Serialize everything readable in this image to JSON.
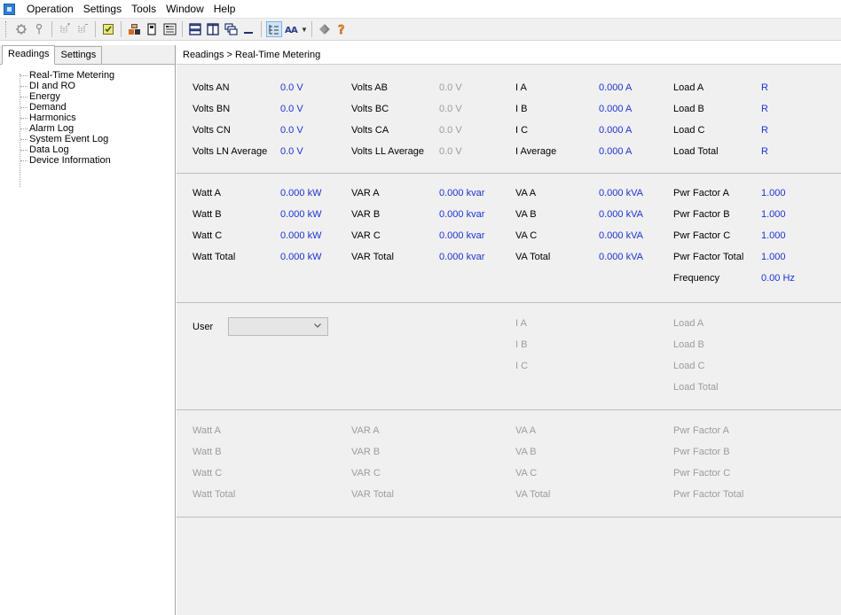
{
  "menu": [
    "Operation",
    "Settings",
    "Tools",
    "Window",
    "Help"
  ],
  "tabs": [
    "Readings",
    "Settings"
  ],
  "tree": [
    "Real-Time Metering",
    "DI and RO",
    "Energy",
    "Demand",
    "Harmonics",
    "Alarm Log",
    "System Event Log",
    "Data Log",
    "Device Information"
  ],
  "breadcrumb": "Readings > Real-Time Metering",
  "sec1": {
    "volts_an_label": "Volts AN",
    "volts_an_value": "0.0 V",
    "volts_bn_label": "Volts BN",
    "volts_bn_value": "0.0 V",
    "volts_cn_label": "Volts CN",
    "volts_cn_value": "0.0 V",
    "volts_ln_avg_label": "Volts LN Average",
    "volts_ln_avg_value": "0.0 V",
    "volts_ab_label": "Volts AB",
    "volts_ab_value": "0.0 V",
    "volts_bc_label": "Volts BC",
    "volts_bc_value": "0.0 V",
    "volts_ca_label": "Volts CA",
    "volts_ca_value": "0.0 V",
    "volts_ll_avg_label": "Volts LL Average",
    "volts_ll_avg_value": "0.0 V",
    "i_a_label": "I A",
    "i_a_value": "0.000 A",
    "i_b_label": "I B",
    "i_b_value": "0.000 A",
    "i_c_label": "I C",
    "i_c_value": "0.000 A",
    "i_avg_label": "I Average",
    "i_avg_value": "0.000 A",
    "load_a_label": "Load A",
    "load_a_value": "R",
    "load_b_label": "Load B",
    "load_b_value": "R",
    "load_c_label": "Load C",
    "load_c_value": "R",
    "load_total_label": "Load Total",
    "load_total_value": "R"
  },
  "sec2": {
    "watt_a_label": "Watt A",
    "watt_a_value": "0.000 kW",
    "watt_b_label": "Watt B",
    "watt_b_value": "0.000 kW",
    "watt_c_label": "Watt C",
    "watt_c_value": "0.000 kW",
    "watt_total_label": "Watt Total",
    "watt_total_value": "0.000 kW",
    "var_a_label": "VAR A",
    "var_a_value": "0.000 kvar",
    "var_b_label": "VAR B",
    "var_b_value": "0.000 kvar",
    "var_c_label": "VAR C",
    "var_c_value": "0.000 kvar",
    "var_total_label": "VAR Total",
    "var_total_value": "0.000 kvar",
    "va_a_label": "VA A",
    "va_a_value": "0.000 kVA",
    "va_b_label": "VA B",
    "va_b_value": "0.000 kVA",
    "va_c_label": "VA C",
    "va_c_value": "0.000 kVA",
    "va_total_label": "VA Total",
    "va_total_value": "0.000 kVA",
    "pf_a_label": "Pwr Factor A",
    "pf_a_value": "1.000",
    "pf_b_label": "Pwr Factor B",
    "pf_b_value": "1.000",
    "pf_c_label": "Pwr Factor C",
    "pf_c_value": "1.000",
    "pf_total_label": "Pwr Factor Total",
    "pf_total_value": "1.000",
    "freq_label": "Frequency",
    "freq_value": "0.00 Hz"
  },
  "sec3": {
    "user_label": "User",
    "user_value": "",
    "i_a": "I A",
    "i_b": "I B",
    "i_c": "I C",
    "load_a": "Load A",
    "load_b": "Load B",
    "load_c": "Load C",
    "load_total": "Load Total"
  },
  "sec4": {
    "watt_a": "Watt A",
    "watt_b": "Watt B",
    "watt_c": "Watt C",
    "watt_total": "Watt Total",
    "var_a": "VAR A",
    "var_b": "VAR B",
    "var_c": "VAR C",
    "var_total": "VAR Total",
    "va_a": "VA A",
    "va_b": "VA B",
    "va_c": "VA C",
    "va_total": "VA Total",
    "pf_a": "Pwr Factor A",
    "pf_b": "Pwr Factor B",
    "pf_c": "Pwr Factor C",
    "pf_total": "Pwr Factor Total"
  },
  "colors": {
    "value_blue": "#1a33d4",
    "disabled_gray": "#9c9c9c",
    "panel_bg": "#f0f0f0"
  },
  "toolbar_icons": [
    "connect-icon",
    "probe-icon",
    "add-device-icon",
    "remove-device-icon",
    "checklist-icon",
    "devices-icon",
    "meter-icon",
    "register-icon",
    "tile-horizontal-icon",
    "tile-vertical-icon",
    "cascade-icon",
    "minimize-all-icon",
    "tree-view-icon",
    "font-size-icon",
    "shape-icon",
    "help-icon"
  ]
}
